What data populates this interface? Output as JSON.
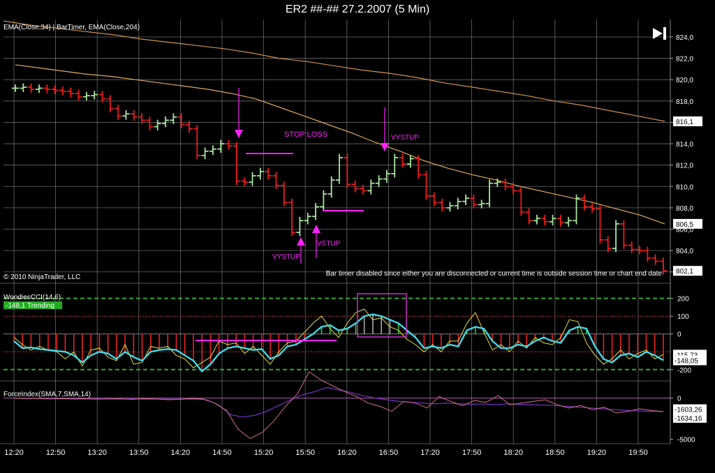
{
  "window": {
    "title": "ER2 ##-##  27.2.2007 (5 Min)"
  },
  "price_panel": {
    "indicator_label": "EMA(Close,34) | BarTimer, EMA(Close,204)",
    "copyright": "© 2010 NinjaTrader, LLC",
    "bar_timer_message": "Bar timer disabled since either you are disconnected or current time is outside session time or chart end date",
    "play_icon": "skip-to-end-icon",
    "annotations": {
      "stop_loss": "STOP LOSS",
      "vystup_left": "VYSTUP",
      "vystup_mid": "VSTUP",
      "vystup_top": "VYSTUP"
    }
  },
  "cci_panel": {
    "indicator_label": "WoodiesCCI(14,6)",
    "badge": "-148,1 Trending"
  },
  "force_panel": {
    "indicator_label": "ForceIndex(SMA,7,SMA,14)"
  },
  "colors": {
    "up": "#a8e6a0",
    "down": "#ee1c1c",
    "ema34": "#e0a860",
    "ema204": "#d09050",
    "magenta": "#ff22ff",
    "cci": "#40d8e8",
    "tcci": "#e8e040",
    "grid": "#6a6a6a"
  },
  "chart_data": [
    {
      "type": "line",
      "title": "ER2 ##-##  27.2.2007 (5 Min)",
      "ylim": [
        801.2,
        825.5
      ],
      "y_ticks": [
        "824,0",
        "822,0",
        "820,0",
        "818,0",
        "816,0",
        "814,0",
        "812,0",
        "810,0",
        "808,0",
        "806,0",
        "804,0",
        "802,0"
      ],
      "y_tick_values": [
        824,
        822,
        820,
        818,
        816,
        814,
        812,
        810,
        808,
        806,
        804,
        802
      ],
      "x_ticks": [
        "12:20",
        "12:50",
        "13:20",
        "13:50",
        "14:20",
        "14:50",
        "15:20",
        "15:50",
        "16:20",
        "16:50",
        "17:20",
        "17:50",
        "18:20",
        "18:50",
        "19:20",
        "19:50"
      ],
      "price_close": [
        819.2,
        819.3,
        819.1,
        819.2,
        819.1,
        819.0,
        818.9,
        818.7,
        818.4,
        818.5,
        818.6,
        818.2,
        817.3,
        816.6,
        816.8,
        816.5,
        816.2,
        815.6,
        815.9,
        816.2,
        816.5,
        815.8,
        815.4,
        812.9,
        813.3,
        813.5,
        814.0,
        813.8,
        810.5,
        810.4,
        811.0,
        811.4,
        811.0,
        810.1,
        808.5,
        805.7,
        806.8,
        807.2,
        808.1,
        809.3,
        810.6,
        812.7,
        810.2,
        809.8,
        809.6,
        810.3,
        810.7,
        811.2,
        812.7,
        812.1,
        812.6,
        811.1,
        809.1,
        808.5,
        808.0,
        808.2,
        808.6,
        808.9,
        808.3,
        808.4,
        810.3,
        810.4,
        810.0,
        809.6,
        807.6,
        806.8,
        807.0,
        806.7,
        807.0,
        806.6,
        806.8,
        808.9,
        808.1,
        807.9,
        805.0,
        804.2,
        806.5,
        804.5,
        804.1,
        804.0,
        803.3,
        803.0,
        802.1
      ],
      "last_price_label": "802,1",
      "ema34_label": "806,5",
      "ema204_label": "816,1",
      "ema34_series": [
        821.4,
        821.1,
        820.8,
        820.5,
        820.3,
        820.0,
        819.7,
        819.4,
        819.1,
        818.7,
        818.2,
        817.4,
        816.6,
        815.8,
        815.0,
        814.1,
        813.3,
        812.4,
        811.7,
        811.1,
        810.6,
        810.0,
        809.5,
        809.0,
        808.5,
        807.9,
        807.3,
        806.5
      ],
      "ema204_series": [
        825.5,
        825.1,
        824.8,
        824.5,
        824.2,
        823.8,
        823.5,
        823.2,
        822.9,
        822.5,
        822.0,
        821.7,
        821.3,
        820.9,
        820.6,
        820.2,
        819.7,
        819.3,
        818.9,
        818.5,
        818.0,
        817.6,
        817.1,
        816.6,
        816.1
      ],
      "series": [
        {
          "name": "EMA(Close,34)"
        },
        {
          "name": "EMA(Close,204)"
        }
      ]
    },
    {
      "type": "line",
      "title": "WoodiesCCI(14,6)",
      "ylim": [
        -240,
        230
      ],
      "y_ticks": [
        "200",
        "100",
        "0",
        "-200"
      ],
      "y_tick_values": [
        200,
        100,
        0,
        -200
      ],
      "value_labels": [
        "-115,73",
        "-148,05"
      ],
      "cci": [
        -40,
        -80,
        -75,
        -85,
        -90,
        -95,
        -100,
        -120,
        -160,
        -120,
        -100,
        -110,
        -140,
        -100,
        -130,
        -150,
        -100,
        -90,
        -85,
        -90,
        -120,
        -150,
        -210,
        -170,
        -110,
        -80,
        -70,
        -80,
        -90,
        -85,
        -140,
        -120,
        -70,
        -60,
        -30,
        0,
        40,
        50,
        20,
        30,
        60,
        100,
        110,
        100,
        80,
        60,
        20,
        -20,
        -80,
        -70,
        -80,
        -60,
        -70,
        20,
        40,
        30,
        -40,
        -80,
        -80,
        -60,
        -70,
        -40,
        -20,
        -40,
        -50,
        20,
        40,
        30,
        -70,
        -140,
        -160,
        -120,
        -110,
        -130,
        -100,
        -120,
        -148
      ],
      "tcci": [
        -20,
        -60,
        -90,
        -70,
        -90,
        -100,
        -140,
        -100,
        -180,
        -90,
        -80,
        -130,
        -150,
        -60,
        -170,
        -160,
        -70,
        -80,
        -70,
        -120,
        -140,
        -190,
        -160,
        -130,
        -40,
        -60,
        -50,
        -110,
        -70,
        -120,
        -170,
        -100,
        -50,
        -40,
        10,
        60,
        100,
        30,
        -20,
        60,
        120,
        140,
        80,
        90,
        40,
        20,
        -30,
        -60,
        -100,
        -60,
        -100,
        -40,
        -40,
        60,
        120,
        10,
        -90,
        -60,
        -100,
        -40,
        -80,
        -20,
        -50,
        -60,
        -20,
        80,
        70,
        -50,
        -120,
        -170,
        -140,
        -90,
        -140,
        -110,
        -90,
        -140,
        -116
      ]
    },
    {
      "type": "line",
      "title": "ForceIndex(SMA,7,SMA,14)",
      "ylim": [
        -5200,
        1500
      ],
      "y_ticks": [
        "0",
        "-5000"
      ],
      "y_tick_values": [
        0,
        -5000
      ],
      "value_labels": [
        "-1603,26",
        "-1634,16"
      ],
      "fast": [
        0,
        -50,
        -20,
        -100,
        -50,
        -100,
        -80,
        -120,
        -100,
        -80,
        -150,
        -60,
        -100,
        -200,
        -150,
        -50,
        -100,
        -600,
        -1500,
        -3800,
        -4900,
        -4200,
        -2800,
        -1000,
        500,
        3200,
        2200,
        1500,
        800,
        200,
        -600,
        -1000,
        -1600,
        -400,
        -600,
        -1200,
        200,
        -400,
        -900,
        -300,
        -500,
        300,
        -800,
        -600,
        -400,
        -200,
        -800,
        -1200,
        -900,
        -1400,
        -1100,
        -1800,
        -1600,
        -1300,
        -1500,
        -1634
      ],
      "slow": [
        0,
        -30,
        -40,
        -60,
        -70,
        -80,
        -90,
        -100,
        -100,
        -110,
        -100,
        -120,
        -110,
        -130,
        -120,
        -110,
        -200,
        -800,
        -2000,
        -2300,
        -2100,
        -1600,
        -900,
        -200,
        400,
        800,
        1300,
        1000,
        700,
        300,
        0,
        -200,
        -400,
        -500,
        -600,
        -700,
        -600,
        -700,
        -750,
        -700,
        -800,
        -700,
        -750,
        -800,
        -850,
        -900,
        -1000,
        -1100,
        -1200,
        -1300,
        -1400,
        -1500,
        -1550,
        -1600,
        -1603
      ]
    }
  ]
}
